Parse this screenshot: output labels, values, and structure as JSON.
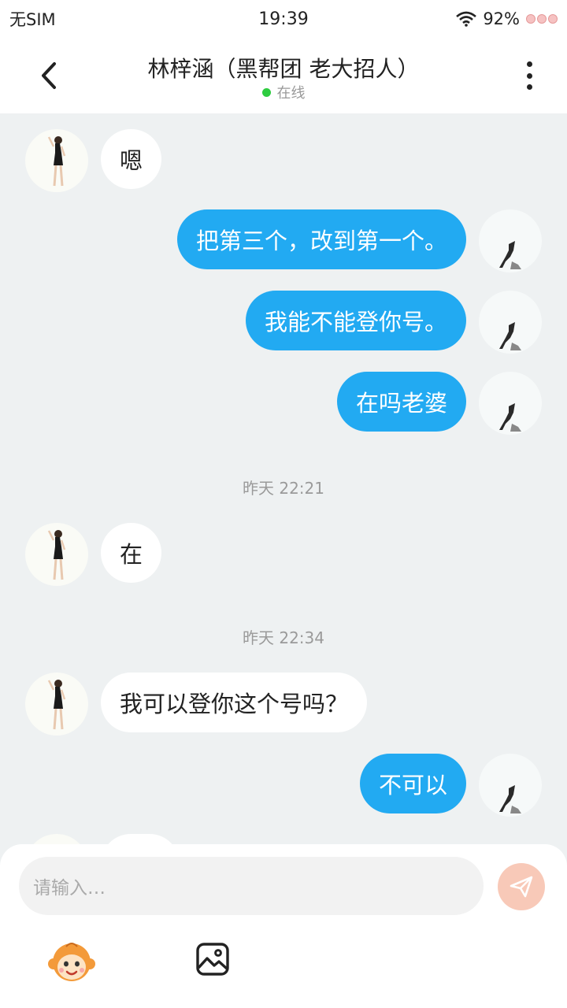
{
  "status_bar": {
    "carrier": "无SIM",
    "time": "19:39",
    "battery": "92%"
  },
  "header": {
    "title": "林梓涵（黑帮团  老大招人）",
    "status": "在线"
  },
  "messages": [
    {
      "side": "left",
      "text": "嗯"
    },
    {
      "side": "right",
      "text": "把第三个，改到第一个。"
    },
    {
      "side": "right",
      "text": "我能不能登你号。"
    },
    {
      "side": "right",
      "text": "在吗老婆"
    },
    {
      "side": "time",
      "text": "昨天 22:21"
    },
    {
      "side": "left",
      "text": "在"
    },
    {
      "side": "time",
      "text": "昨天 22:34"
    },
    {
      "side": "left",
      "text": "我可以登你这个号吗？"
    },
    {
      "side": "right",
      "text": "不可以"
    }
  ],
  "input": {
    "placeholder": "请输入…"
  },
  "colors": {
    "outgoing_bubble": "#22aaf2",
    "incoming_bubble": "#ffffff",
    "chat_background": "#eef1f2",
    "online_dot": "#2ecc40",
    "send_button": "#f8c9b8"
  },
  "icons": [
    "back-arrow-icon",
    "more-vertical-icon",
    "wifi-icon",
    "send-icon",
    "emoji-monkey-icon",
    "image-icon"
  ]
}
